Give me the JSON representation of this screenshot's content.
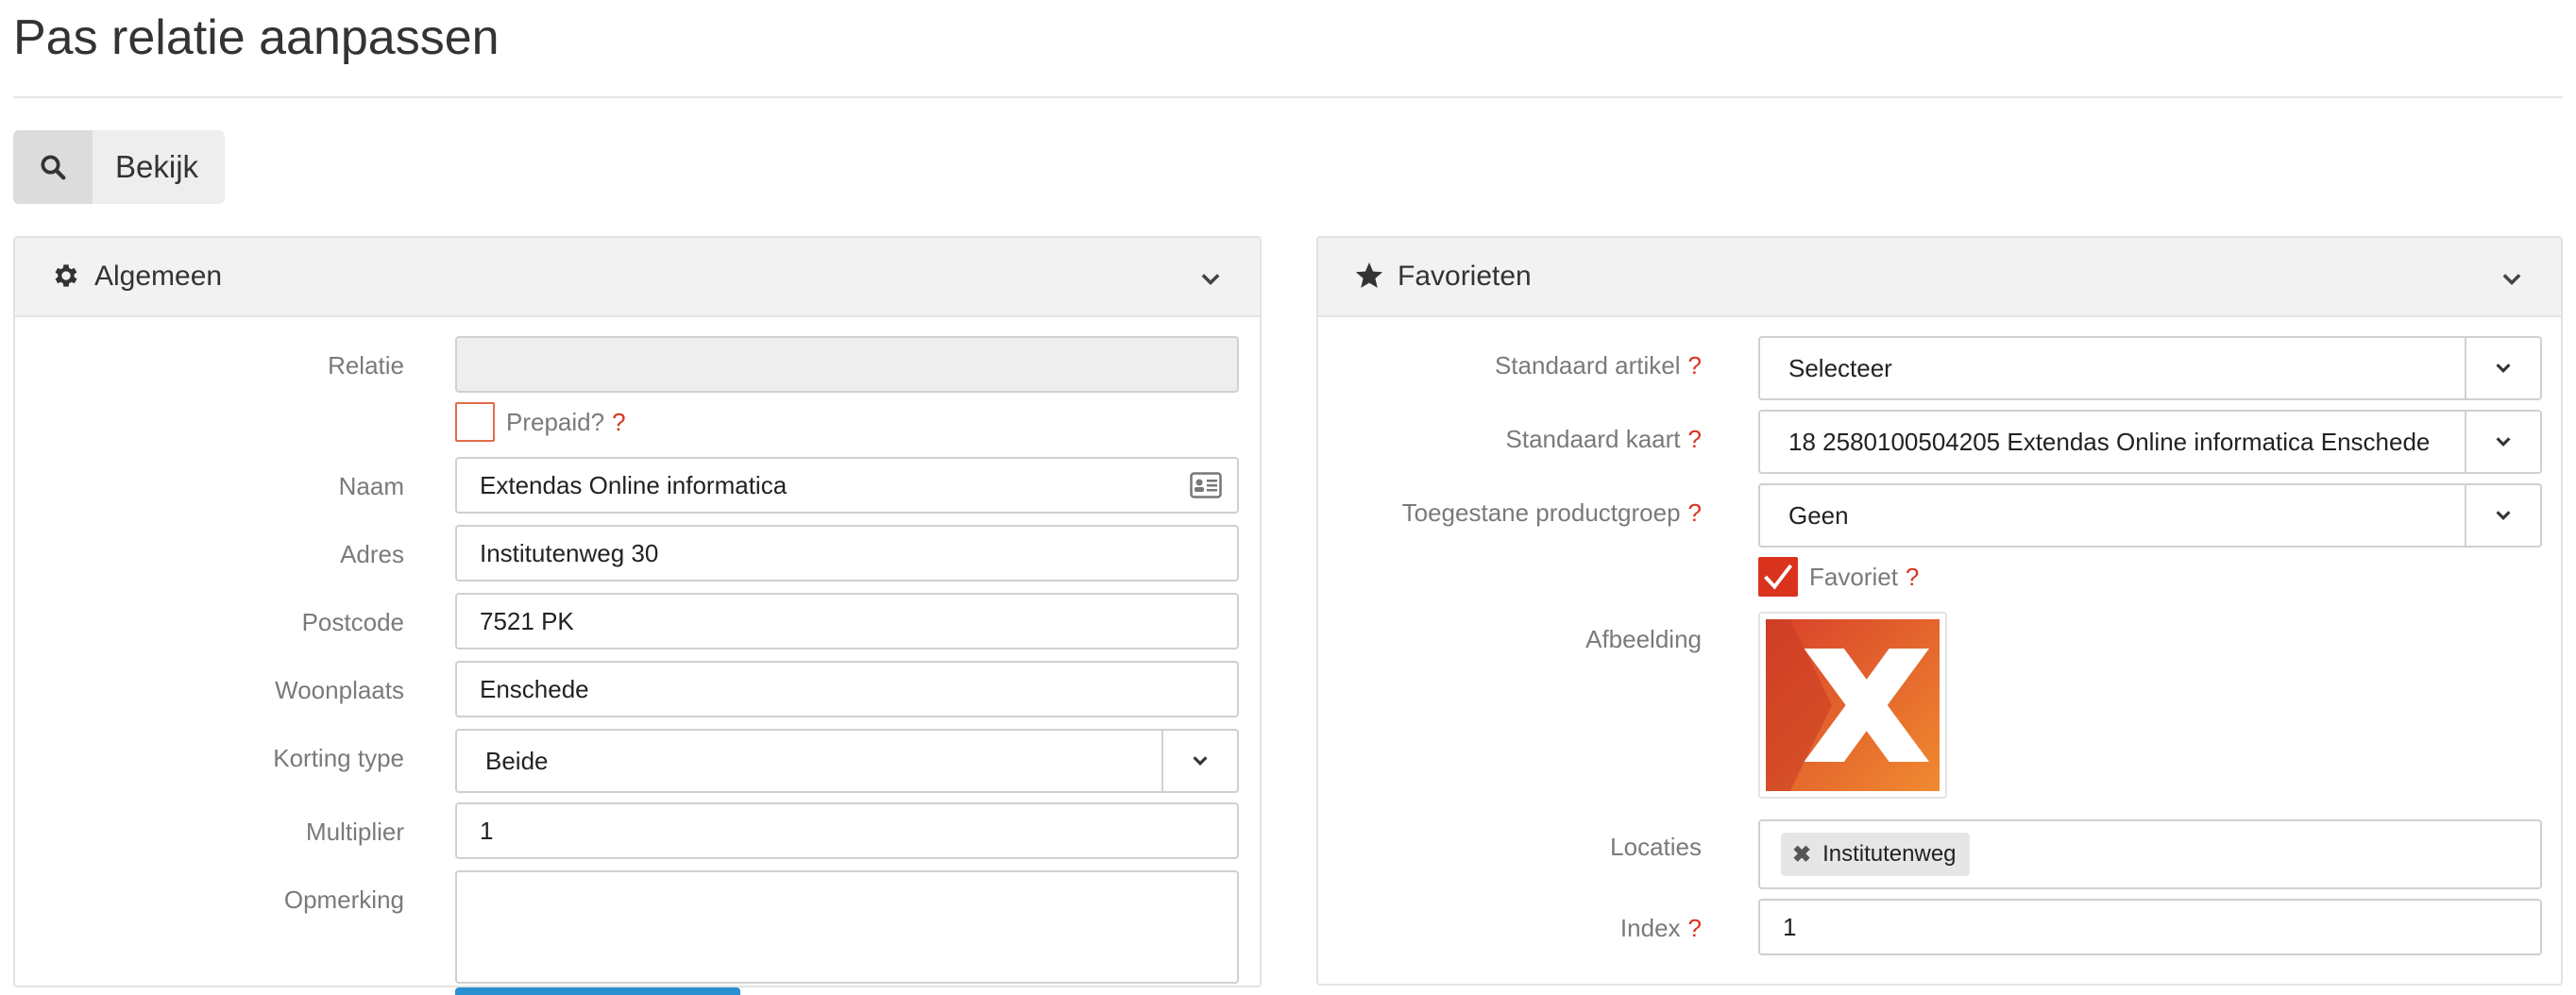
{
  "page": {
    "title": "Pas relatie aanpassen"
  },
  "toolbar": {
    "view_label": "Bekijk",
    "view_icon": "search-icon"
  },
  "left_panel": {
    "title": "Algemeen",
    "icon": "gear-icon",
    "fields": {
      "relatie": {
        "label": "Relatie",
        "value": ""
      },
      "prepaid": {
        "label": "Prepaid?",
        "help": "?",
        "checked": false
      },
      "naam": {
        "label": "Naam",
        "value": "Extendas Online informatica"
      },
      "adres": {
        "label": "Adres",
        "value": "Institutenweg 30"
      },
      "postcode": {
        "label": "Postcode",
        "value": "7521 PK"
      },
      "woonplaats": {
        "label": "Woonplaats",
        "value": "Enschede"
      },
      "korting_type": {
        "label": "Korting type",
        "value": "Beide"
      },
      "multiplier": {
        "label": "Multiplier",
        "value": "1"
      },
      "opmerking": {
        "label": "Opmerking",
        "value": ""
      }
    }
  },
  "right_panel": {
    "title": "Favorieten",
    "icon": "star-icon",
    "fields": {
      "standaard_artikel": {
        "label": "Standaard artikel",
        "help": "?",
        "value": "Selecteer"
      },
      "standaard_kaart": {
        "label": "Standaard kaart",
        "help": "?",
        "value": "18 2580100504205 Extendas Online informatica Enschede"
      },
      "productgroep": {
        "label": "Toegestane productgroep",
        "help": "?",
        "value": "Geen"
      },
      "favoriet": {
        "label": "Favoriet",
        "help": "?",
        "checked": true
      },
      "afbeelding": {
        "label": "Afbeelding"
      },
      "locaties": {
        "label": "Locaties",
        "tags": [
          "Institutenweg"
        ]
      },
      "index": {
        "label": "Index",
        "help": "?",
        "value": "1"
      }
    }
  },
  "colors": {
    "accent": "#d9331e",
    "logo_start": "#d94a2a",
    "logo_end": "#ef7f2e"
  }
}
